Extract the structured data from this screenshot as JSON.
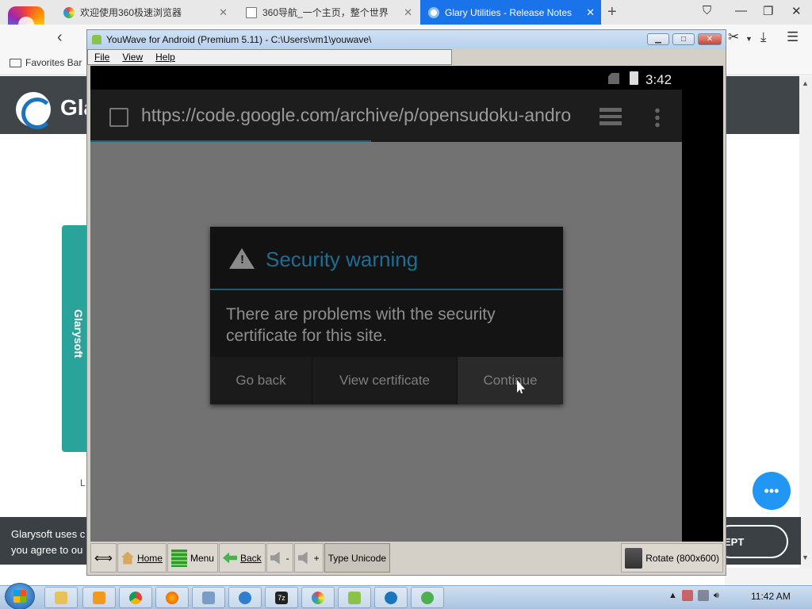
{
  "browser": {
    "tabs": [
      {
        "title": "欢迎使用360极速浏览器",
        "active": false
      },
      {
        "title": "360导航_一个主页，整个世界",
        "active": false
      },
      {
        "title": "Glary Utilities - Release Notes",
        "active": true
      }
    ],
    "favorites_bar_label": "Favorites Bar",
    "accent_color": "#1a73e8"
  },
  "site": {
    "logo_text": "Gla",
    "side_tab_label": "Glarysoft",
    "stray_text": "L",
    "cookie_text_line1": "Glarysoft uses c",
    "cookie_text_line2": "you agree to ou",
    "accept_label": "EPT"
  },
  "youwave": {
    "title": "YouWave for Android (Premium 5.11) - C:\\Users\\vm1\\youwave\\",
    "menu": [
      "File",
      "View",
      "Help"
    ],
    "toolbar": {
      "home": "Home",
      "menu": "Menu",
      "back": "Back",
      "vol_down": "-",
      "vol_up": "+",
      "type_unicode": "Type Unicode",
      "rotate": "Rotate (800x600)"
    }
  },
  "android": {
    "status_time": "3:42",
    "url": "https://code.google.com/archive/p/opensudoku-andro",
    "dialog": {
      "title": "Security warning",
      "message": "There are problems with the security certificate for this site.",
      "buttons": {
        "go_back": "Go back",
        "view_certificate": "View certificate",
        "continue": "Continue"
      },
      "title_color": "#1e6e94"
    }
  },
  "taskbar": {
    "clock": "11:42 AM"
  }
}
